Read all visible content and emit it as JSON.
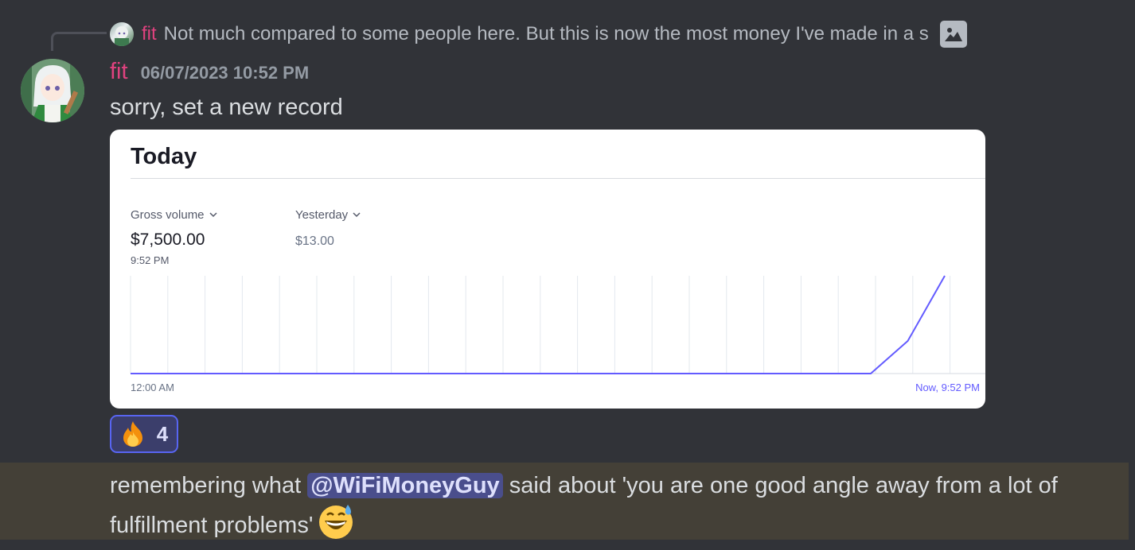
{
  "reply": {
    "author": "fit",
    "text": "Not much compared to some people here. But this is now the most money I've made in a s",
    "attachment_icon": "image-icon"
  },
  "message": {
    "author": "fit",
    "timestamp": "06/07/2023 10:52 PM",
    "text": "sorry, set a new record"
  },
  "embed": {
    "title": "Today",
    "metric_label": "Gross volume",
    "metric_value": "$7,500.00",
    "metric_time": "9:52 PM",
    "compare_label": "Yesterday",
    "compare_value": "$13.00"
  },
  "chart_data": {
    "type": "line",
    "title": "",
    "xlabel": "",
    "ylabel": "",
    "x": [
      "12:00 AM",
      "",
      "",
      "",
      "",
      "",
      "",
      "",
      "",
      "",
      "",
      "",
      "",
      "",
      "",
      "",
      "",
      "",
      "",
      "",
      "",
      "",
      "Now, 9:52 PM"
    ],
    "series": [
      {
        "values": [
          0,
          0,
          0,
          0,
          0,
          0,
          0,
          0,
          0,
          0,
          0,
          0,
          0,
          0,
          0,
          0,
          0,
          0,
          0,
          0,
          0,
          2500,
          7500
        ]
      }
    ],
    "ylim": [
      0,
      7500
    ],
    "x_tick_labels": [
      "12:00 AM",
      "Now, 9:52 PM"
    ],
    "grid": "vertical",
    "line_color": "#635bff"
  },
  "reaction": {
    "emoji": "fire-emoji",
    "count": "4",
    "accent": "#5865f2"
  },
  "followup": {
    "before": "remembering what ",
    "mention": "@WiFiMoneyGuy",
    "after": " said about 'you are one good angle away from a lot of fulfillment problems'",
    "emoji": "grinning-sweat-emoji"
  }
}
